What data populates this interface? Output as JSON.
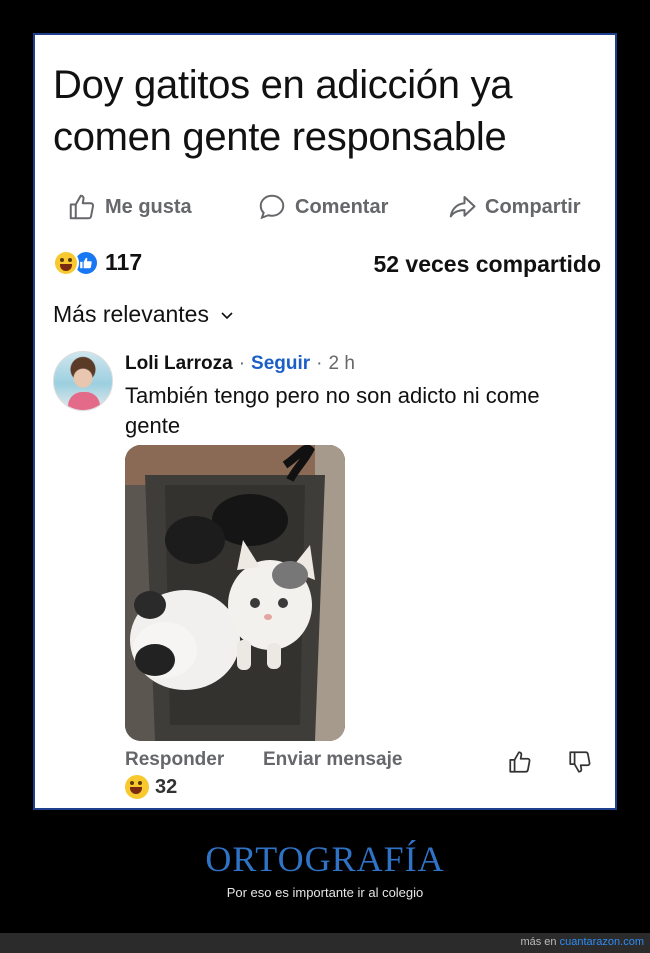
{
  "post": {
    "title": "Doy gatitos en adicción ya comen gente responsable",
    "actions": {
      "like": "Me gusta",
      "comment": "Comentar",
      "share": "Compartir"
    },
    "reaction_count": "117",
    "shares": "52 veces compartido",
    "sort_label": "Más relevantes"
  },
  "comment": {
    "author": "Loli Larroza",
    "separator": "·",
    "follow": "Seguir",
    "separator2": "·",
    "time": "2 h",
    "text": "También tengo pero no son adicto ni come gente",
    "reply": "Responder",
    "send_message": "Enviar mensaje",
    "reaction_count": "32"
  },
  "caption": {
    "title": "ORTOGRAFÍA",
    "subtitle": "Por eso es importante ir al colegio"
  },
  "footer": {
    "prefix": "más en",
    "link": "cuantarazon.com"
  },
  "colors": {
    "accent_blue": "#1a5fc8",
    "card_border": "#1f3f8f",
    "caption_blue": "#2f73c7",
    "muted_gray": "#65676b"
  },
  "icons": [
    "thumbs-up-icon",
    "comment-bubble-icon",
    "share-arrow-icon",
    "haha-emoji-icon",
    "like-emoji-icon",
    "chevron-down-icon",
    "thumbs-down-icon"
  ]
}
